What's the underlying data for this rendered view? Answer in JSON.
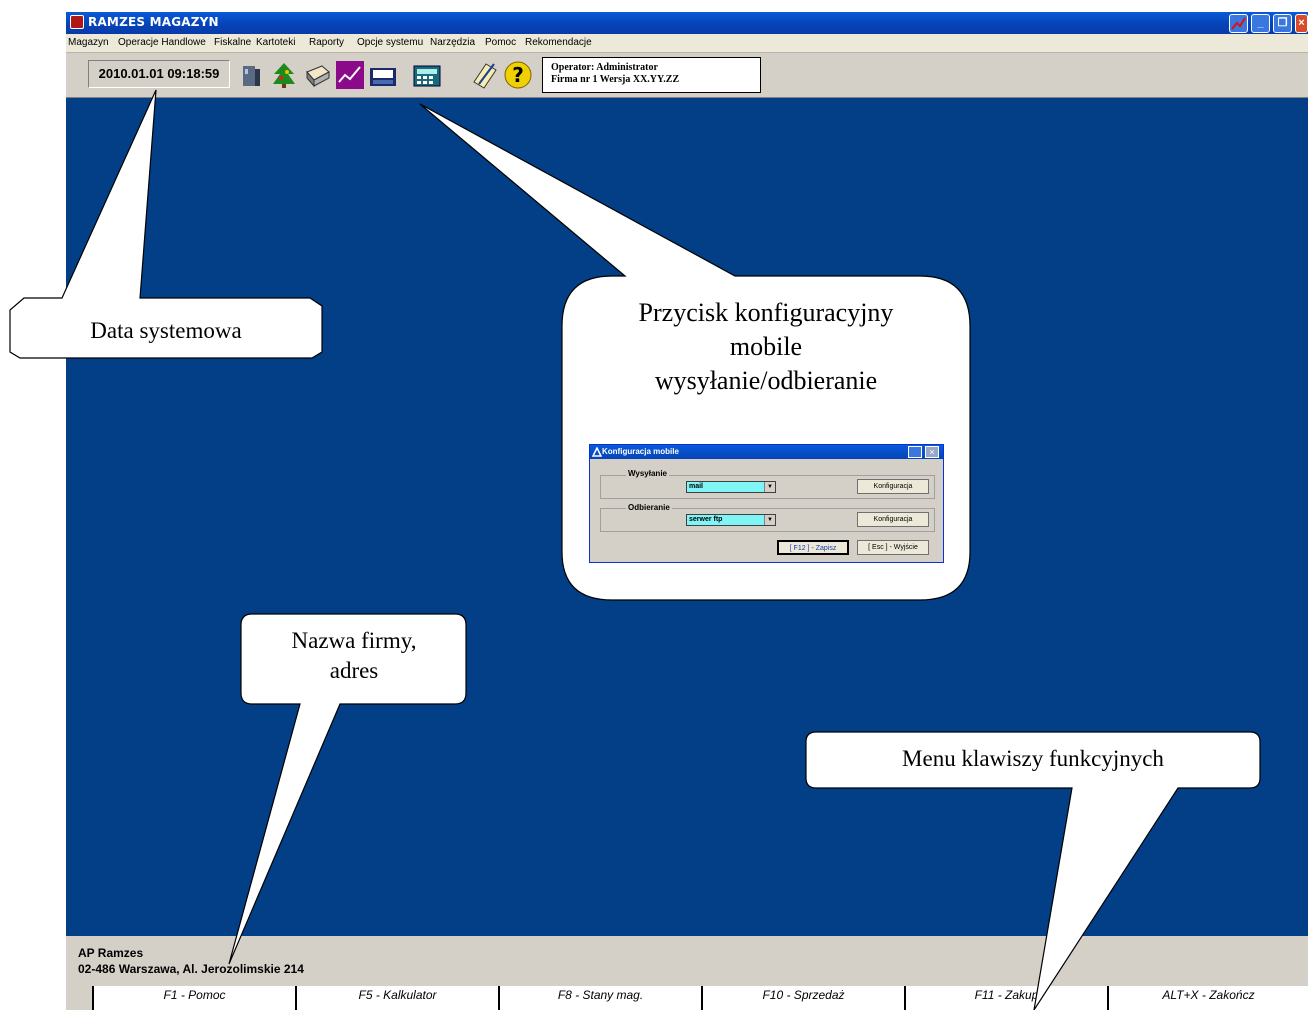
{
  "window": {
    "title": "RAMZES MAGAZYN"
  },
  "menu": [
    "Magazyn",
    "Operacje Handlowe",
    "Fiskalne",
    "Kartoteki",
    "Raporty",
    "Opcje systemu",
    "Narzędzia",
    "Pomoc",
    "Rekomendacje"
  ],
  "toolbar": {
    "datetime": "2010.01.01 09:18:59",
    "operator_line": "Operator: Administrator",
    "firm_line": "Firma nr 1   Wersja XX.YY.ZZ"
  },
  "company": {
    "name": "AP Ramzes",
    "address": "02-486 Warszawa, Al. Jerozolimskie 214"
  },
  "fkeys": [
    "F1 - Pomoc",
    "F5 - Kalkulator",
    "F8 - Stany mag.",
    "F10 - Sprzedaż",
    "F11 - Zakup",
    "ALT+X - Zakończ"
  ],
  "callouts": {
    "date": "Data systemowa",
    "config": [
      "Przycisk konfiguracyjny",
      "mobile",
      "wysyłanie/odbieranie"
    ],
    "company": [
      "Nazwa firmy,",
      "adres"
    ],
    "fkeys": "Menu klawiszy funkcyjnych"
  },
  "dialog": {
    "title": "Konfiguracja mobile",
    "send_label": "Wysyłanie",
    "send_value": "mail",
    "recv_label": "Odbieranie",
    "recv_value": "serwer ftp",
    "config_button": "Konfiguracja",
    "save_button": "[ F12 ] - Zapisz",
    "exit_button": "[ Esc ] - Wyjście"
  },
  "colors": {
    "workarea": "#023f86",
    "titlebar": "#0544b8",
    "chrome": "#d4d0c8",
    "combo": "#7ff5f5"
  }
}
